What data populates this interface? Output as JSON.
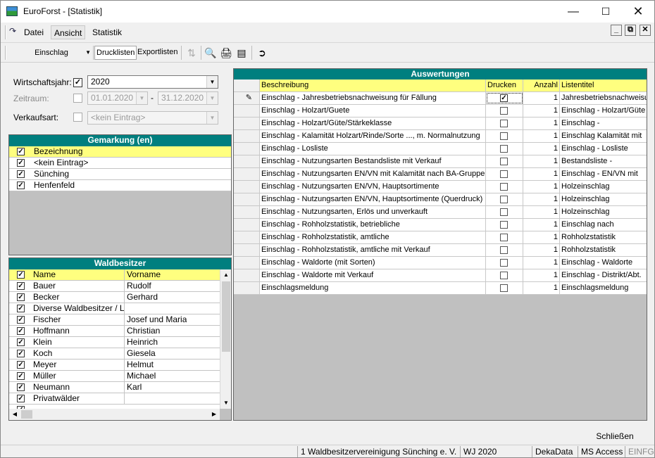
{
  "window": {
    "app_title": "EuroForst - [Statistik]"
  },
  "menu": {
    "items": [
      "Datei",
      "Ansicht",
      "Statistik"
    ]
  },
  "toolbar": {
    "combo_value": "Einschlag",
    "tab_drucklisten": "Drucklisten",
    "tab_exportlisten": "Exportlisten"
  },
  "filters": {
    "wirtschaftsjahr_label": "Wirtschaftsjahr:",
    "wirtschaftsjahr_value": "2020",
    "wirtschaftsjahr_checked": true,
    "zeitraum_label": "Zeitraum:",
    "zeitraum_from": "01.01.2020",
    "zeitraum_dash": "-",
    "zeitraum_to": "31.12.2020",
    "verkaufsart_label": "Verkaufsart:",
    "verkaufsart_value": "<kein Eintrag>"
  },
  "gemarkung": {
    "title": "Gemarkung (en)",
    "header": "Bezeichnung",
    "rows": [
      "<kein Eintrag>",
      "Sünching",
      "Henfenfeld"
    ]
  },
  "waldbesitzer": {
    "title": "Waldbesitzer",
    "col_name": "Name",
    "col_vorname": "Vorname",
    "rows": [
      {
        "name": "Bauer",
        "vorname": "Rudolf"
      },
      {
        "name": "Becker",
        "vorname": "Gerhard"
      },
      {
        "name": "Diverse Waldbesitzer / Lief",
        "vorname": ""
      },
      {
        "name": "Fischer",
        "vorname": "Josef und Maria"
      },
      {
        "name": "Hoffmann",
        "vorname": "Christian"
      },
      {
        "name": "Klein",
        "vorname": "Heinrich"
      },
      {
        "name": "Koch",
        "vorname": "Giesela"
      },
      {
        "name": "Meyer",
        "vorname": "Helmut"
      },
      {
        "name": "Müller",
        "vorname": "Michael"
      },
      {
        "name": "Neumann",
        "vorname": "Karl"
      },
      {
        "name": "Privatwälder",
        "vorname": ""
      }
    ]
  },
  "auswertungen": {
    "title": "Auswertungen",
    "col_beschreibung": "Beschreibung",
    "col_drucken": "Drucken",
    "col_anzahl": "Anzahl",
    "col_listentitel": "Listentitel",
    "rows": [
      {
        "beschreibung": "Einschlag - Jahresbetriebsnachweisung für Fällung",
        "drucken": true,
        "anzahl": "1",
        "listentitel": "Jahresbetriebsnachweisu"
      },
      {
        "beschreibung": "Einschlag - Holzart/Guete",
        "drucken": false,
        "anzahl": "1",
        "listentitel": "Einschlag - Holzart/Güte"
      },
      {
        "beschreibung": "Einschlag - Holzart/Güte/Stärkeklasse",
        "drucken": false,
        "anzahl": "1",
        "listentitel": "Einschlag -"
      },
      {
        "beschreibung": "Einschlag - Kalamität Holzart/Rinde/Sorte ..., m. Normalnutzung",
        "drucken": false,
        "anzahl": "1",
        "listentitel": "Einschlag Kalamität mit"
      },
      {
        "beschreibung": "Einschlag - Losliste",
        "drucken": false,
        "anzahl": "1",
        "listentitel": "Einschlag - Losliste"
      },
      {
        "beschreibung": "Einschlag - Nutzungsarten Bestandsliste mit Verkauf",
        "drucken": false,
        "anzahl": "1",
        "listentitel": "Bestandsliste -"
      },
      {
        "beschreibung": "Einschlag - Nutzungsarten EN/VN mit Kalamität nach BA-Gruppen",
        "drucken": false,
        "anzahl": "1",
        "listentitel": "Einschlag - EN/VN mit"
      },
      {
        "beschreibung": "Einschlag - Nutzungsarten EN/VN, Hauptsortimente",
        "drucken": false,
        "anzahl": "1",
        "listentitel": "Holzeinschlag"
      },
      {
        "beschreibung": "Einschlag - Nutzungsarten EN/VN, Hauptsortimente (Querdruck)",
        "drucken": false,
        "anzahl": "1",
        "listentitel": "Holzeinschlag"
      },
      {
        "beschreibung": "Einschlag - Nutzungsarten, Erlös und unverkauft",
        "drucken": false,
        "anzahl": "1",
        "listentitel": "Holzeinschlag"
      },
      {
        "beschreibung": "Einschlag - Rohholzstatistik, betriebliche",
        "drucken": false,
        "anzahl": "1",
        "listentitel": "Einschlag nach"
      },
      {
        "beschreibung": "Einschlag - Rohholzstatistik, amtliche",
        "drucken": false,
        "anzahl": "1",
        "listentitel": "Rohholzstatistik"
      },
      {
        "beschreibung": "Einschlag - Rohholzstatistik, amtliche  mit Verkauf",
        "drucken": false,
        "anzahl": "1",
        "listentitel": "Rohholzstatistik"
      },
      {
        "beschreibung": "Einschlag - Waldorte (mit Sorten)",
        "drucken": false,
        "anzahl": "1",
        "listentitel": "Einschlag - Waldorte"
      },
      {
        "beschreibung": "Einschlag - Waldorte mit Verkauf",
        "drucken": false,
        "anzahl": "1",
        "listentitel": "Einschlag - Distrikt/Abt."
      },
      {
        "beschreibung": "Einschlagsmeldung",
        "drucken": false,
        "anzahl": "1",
        "listentitel": "Einschlagsmeldung"
      }
    ]
  },
  "buttons": {
    "schliessen": "Schließen"
  },
  "statusbar": {
    "org": "1 Waldbesitzervereinigung Sünching e. V.",
    "wj": "WJ 2020",
    "company": "DekaData",
    "db": "MS Access",
    "mode": "EINFG"
  }
}
